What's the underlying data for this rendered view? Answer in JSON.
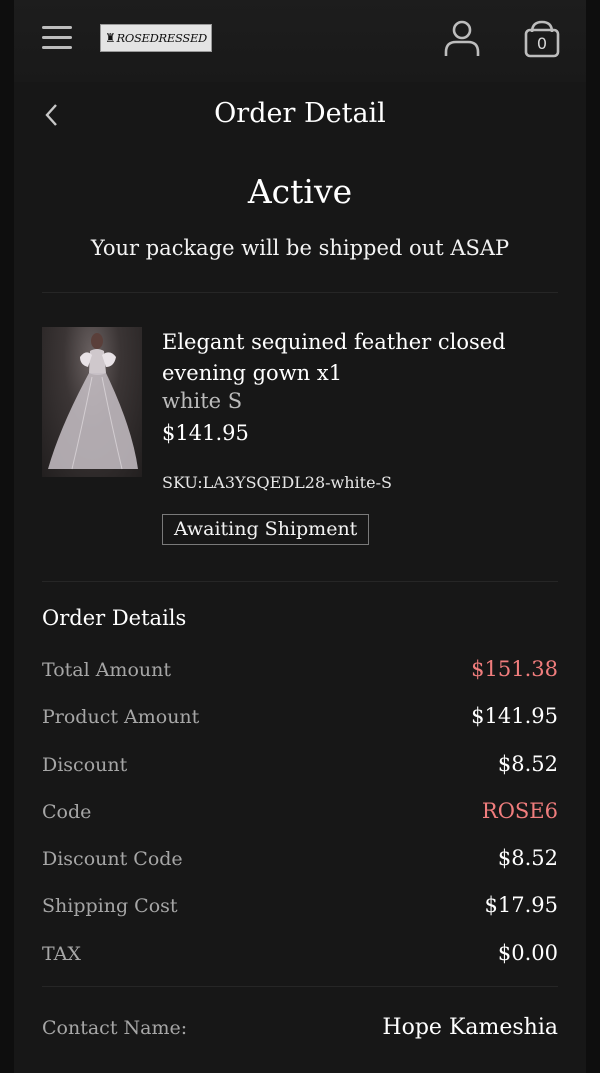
{
  "header": {
    "logo_text": "ROSEDRESSED",
    "cart_count": "0",
    "icons": [
      "menu-icon",
      "user-icon",
      "shopping-bag-icon"
    ]
  },
  "titlebar": {
    "title": "Order Detail"
  },
  "status": {
    "title": "Active",
    "subtitle": "Your package will be shipped out ASAP"
  },
  "product": {
    "name": "Elegant sequined feather closed evening gown x1",
    "variant": "white S",
    "price": "$141.95",
    "sku": "SKU:LA3YSQEDL28-white-S",
    "shipment_status": "Awaiting Shipment"
  },
  "order_details": {
    "title": "Order Details",
    "rows": [
      {
        "label": "Total Amount",
        "value": "$151.38"
      },
      {
        "label": "Product Amount",
        "value": "$141.95"
      },
      {
        "label": "Discount",
        "value": "$8.52"
      },
      {
        "label": "Code",
        "value": "ROSE6"
      },
      {
        "label": "Discount Code",
        "value": "$8.52"
      },
      {
        "label": "Shipping Cost",
        "value": "$17.95"
      },
      {
        "label": "TAX",
        "value": "$0.00"
      }
    ]
  },
  "contact": {
    "label": "Contact Name:",
    "value": "Hope Kameshia"
  },
  "colors": {
    "background": "#171717",
    "accent": "#f07d7d",
    "muted_text": "#a6a6a6"
  }
}
